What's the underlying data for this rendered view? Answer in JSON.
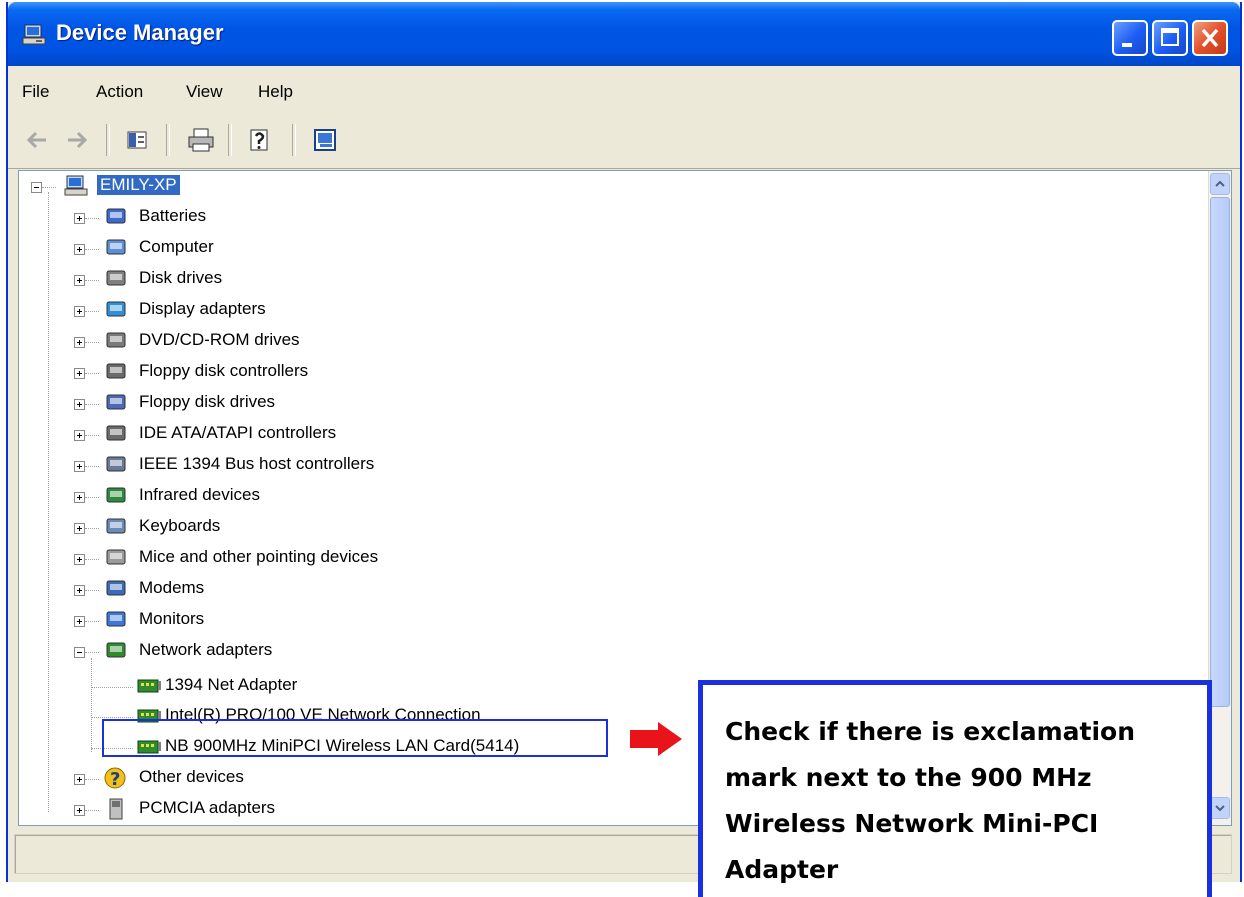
{
  "window": {
    "title": "Device Manager",
    "title_icon": "computer-icon",
    "buttons": [
      "minimize-icon",
      "maximize-icon",
      "close-icon"
    ]
  },
  "menu": [
    "File",
    "Action",
    "View",
    "Help"
  ],
  "toolbar": {
    "tools": [
      "back-arrow-icon",
      "forward-arrow-icon",
      "show-hide-console-tree-icon",
      "print-icon",
      "help-icon",
      "properties-icon"
    ]
  },
  "tree": {
    "root": "EMILY-XP",
    "categories": [
      "Batteries",
      "Computer",
      "Disk drives",
      "Display adapters",
      "DVD/CD-ROM drives",
      "Floppy disk controllers",
      "Floppy disk drives",
      "IDE ATA/ATAPI controllers",
      "IEEE 1394 Bus host controllers",
      "Infrared devices",
      "Keyboards",
      "Mice and other pointing devices",
      "Modems",
      "Monitors",
      "Network adapters"
    ],
    "network_children": [
      "1394 Net Adapter",
      "Intel(R) PRO/100 VE Network Connection",
      "NB 900MHz MiniPCI Wireless LAN Card(5414)"
    ],
    "after": [
      "Other devices",
      "PCMCIA adapters"
    ]
  },
  "callout": {
    "text": "Check if there is exclamation mark next to the 900 MHz Wireless Network Mini-PCI Adapter"
  },
  "colors": {
    "titlebar": "#0055e5",
    "callout_border": "#1a30e0",
    "arrow": "#e8141a",
    "selection": "#316ac5"
  }
}
